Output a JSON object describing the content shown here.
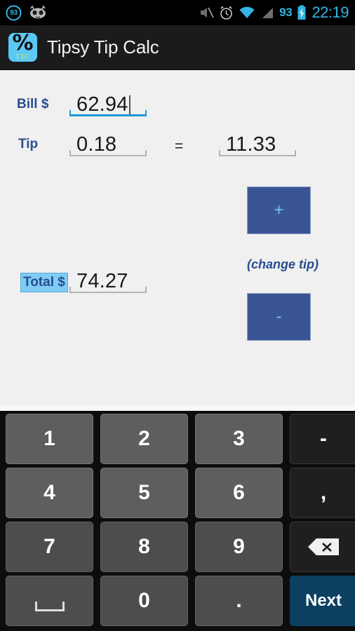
{
  "statusbar": {
    "battery_ring_pct": "93",
    "icons": [
      "cyanogenmod-mascot-icon",
      "mute-icon",
      "alarm-icon",
      "wifi-icon",
      "signal-icon"
    ],
    "battery_percent": "93",
    "clock": "22:19"
  },
  "actionbar": {
    "app_icon_symbol": "%",
    "app_icon_sub": "TTC",
    "title": "Tipsy Tip Calc"
  },
  "form": {
    "bill_label": "Bill $",
    "bill_value": "62.94",
    "tip_label": "Tip",
    "tip_value": "0.18",
    "equals": "=",
    "tip_amount": "11.33",
    "total_label": "Total $",
    "total_value": "74.27",
    "plus_label": "+",
    "minus_label": "-",
    "change_tip_label": "(change tip)"
  },
  "keyboard": {
    "rows": [
      [
        {
          "label": "1",
          "type": "num"
        },
        {
          "label": "2",
          "type": "num"
        },
        {
          "label": "3",
          "type": "num"
        },
        {
          "label": "-",
          "type": "fn"
        }
      ],
      [
        {
          "label": "4",
          "type": "num"
        },
        {
          "label": "5",
          "type": "num"
        },
        {
          "label": "6",
          "type": "num"
        },
        {
          "label": ",",
          "type": "fn"
        }
      ],
      [
        {
          "label": "7",
          "type": "num"
        },
        {
          "label": "8",
          "type": "num"
        },
        {
          "label": "9",
          "type": "num"
        },
        {
          "label": "",
          "type": "backspace"
        }
      ],
      [
        {
          "label": "",
          "type": "space"
        },
        {
          "label": "0",
          "type": "num"
        },
        {
          "label": ".",
          "type": "num"
        },
        {
          "label": "Next",
          "type": "next"
        }
      ]
    ]
  },
  "colors": {
    "accent_blue": "#33b5e5",
    "label_blue": "#2a4d8f",
    "button_blue": "#3a5596",
    "highlight_blue": "#7fcdf5",
    "next_key": "#0b4060",
    "background": "#f0f0f0"
  }
}
